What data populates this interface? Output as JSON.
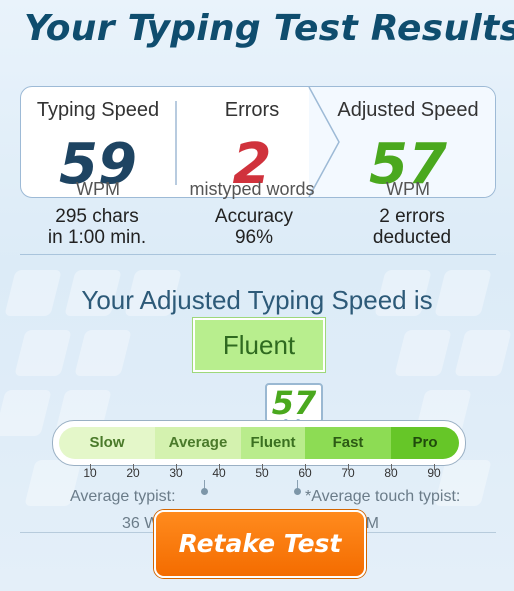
{
  "header": {
    "title": "Your Typing Test Results"
  },
  "summary": {
    "typing_speed": {
      "label": "Typing Speed",
      "value": "59",
      "unit": "WPM",
      "detail_line1": "295 chars",
      "detail_line2": "in 1:00 min."
    },
    "errors": {
      "label": "Errors",
      "value": "2",
      "unit": "mistyped words",
      "detail_line1": "Accuracy",
      "detail_line2": "96%"
    },
    "adjusted_speed": {
      "label": "Adjusted Speed",
      "value": "57",
      "unit": "WPM",
      "detail_line1": "2 errors",
      "detail_line2": "deducted"
    }
  },
  "rating": {
    "heading": "Your Adjusted Typing Speed is",
    "level": "Fluent",
    "marker_value": "57",
    "levels": [
      {
        "name": "Slow",
        "color": "#e4f7c9",
        "text_color": "#4a7a2a"
      },
      {
        "name": "Average",
        "color": "#d4f2af",
        "text_color": "#4a7a2a"
      },
      {
        "name": "Fluent",
        "color": "#b9ec8c",
        "text_color": "#3a7020"
      },
      {
        "name": "Fast",
        "color": "#8ddc54",
        "text_color": "#2c5a14"
      },
      {
        "name": "Pro",
        "color": "#66c628",
        "text_color": "#1f4a0c"
      }
    ],
    "ticks": [
      "10",
      "20",
      "30",
      "40",
      "50",
      "60",
      "70",
      "80",
      "90"
    ],
    "average_typist": {
      "label": "Average typist:",
      "value": "36 W"
    },
    "average_touch_typist": {
      "label": "*Average touch typist:",
      "value": "PM"
    }
  },
  "actions": {
    "retake_label": "Retake Test"
  },
  "colors": {
    "title": "#0f4d6e",
    "typing_speed": "#1e4462",
    "errors": "#d0323c",
    "adjusted": "#4aa81e",
    "button": "#f47a0a"
  }
}
